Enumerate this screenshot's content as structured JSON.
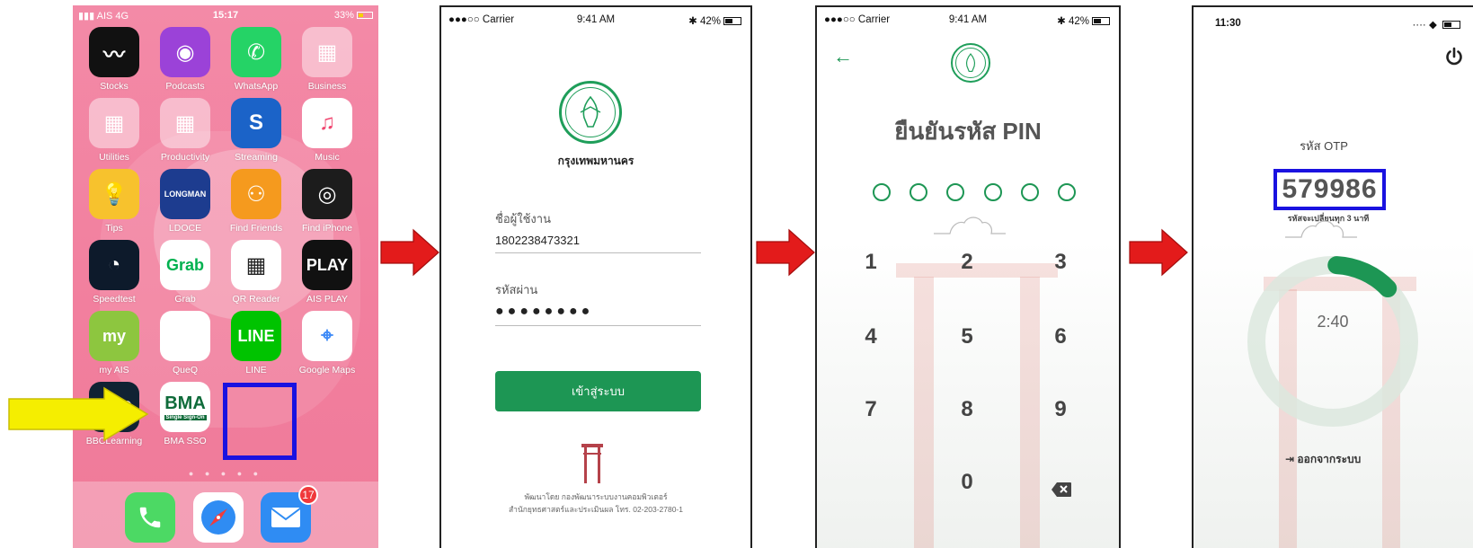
{
  "colors": {
    "accent_green": "#1d9654",
    "highlight_blue": "#1a12e0",
    "arrow_red": "#e31b1b",
    "arrow_yellow": "#f5ee00",
    "home_pink": "#f27f9e"
  },
  "screen1": {
    "status": {
      "carrier": "AIS",
      "network": "4G",
      "time": "15:17",
      "battery": "33%"
    },
    "apps": [
      {
        "label": "Stocks",
        "icon": "stocks-icon"
      },
      {
        "label": "Podcasts",
        "icon": "podcasts-icon"
      },
      {
        "label": "WhatsApp",
        "icon": "whatsapp-icon"
      },
      {
        "label": "Business",
        "icon": "folder-icon"
      },
      {
        "label": "Utilities",
        "icon": "folder-icon"
      },
      {
        "label": "Productivity",
        "icon": "folder-icon"
      },
      {
        "label": "Streaming",
        "icon": "shazam-icon"
      },
      {
        "label": "Music",
        "icon": "music-icon"
      },
      {
        "label": "Tips",
        "icon": "lightbulb-icon"
      },
      {
        "label": "LDOCE",
        "icon": "longman-icon",
        "icon_text": "LONGMAN"
      },
      {
        "label": "Find Friends",
        "icon": "friends-icon"
      },
      {
        "label": "Find iPhone",
        "icon": "radar-icon"
      },
      {
        "label": "Speedtest",
        "icon": "speedometer-icon"
      },
      {
        "label": "Grab",
        "icon": "grab-icon",
        "icon_text": "Grab"
      },
      {
        "label": "QR Reader",
        "icon": "qr-code-icon"
      },
      {
        "label": "AIS PLAY",
        "icon": "play-icon",
        "icon_text": "PLAY"
      },
      {
        "label": "my AIS",
        "icon": "my-ais-icon",
        "icon_text": "my"
      },
      {
        "label": "QueQ",
        "icon": "queq-icon"
      },
      {
        "label": "LINE",
        "icon": "line-icon",
        "icon_text": "LINE"
      },
      {
        "label": "Google Maps",
        "icon": "map-icon"
      },
      {
        "label": "BBCLearning",
        "icon": "bbc-icon",
        "icon_text": "BBC"
      },
      {
        "label": "BMA SSO",
        "icon": "bma-sso-icon",
        "icon_text": "BMA",
        "icon_subtext": "Single Sign-On"
      }
    ],
    "dock": [
      {
        "icon": "phone-icon"
      },
      {
        "icon": "safari-icon"
      },
      {
        "icon": "mail-icon",
        "badge": "17"
      }
    ]
  },
  "screen2": {
    "status": {
      "carrier": "●●●○○ Carrier",
      "time": "9:41 AM",
      "battery": "42%"
    },
    "org_name": "กรุงเทพมหานคร",
    "username_label": "ชื่อผู้ใช้งาน",
    "username_value": "1802238473321",
    "password_label": "รหัสผ่าน",
    "password_value": "●●●●●●●●",
    "login_button": "เข้าสู่ระบบ",
    "footer_line1": "พัฒนาโดย กองพัฒนาระบบงานคอมพิวเตอร์",
    "footer_line2": "สำนักยุทธศาสตร์และประเมินผล โทร. 02-203-2780-1"
  },
  "screen3": {
    "status": {
      "carrier": "●●●○○ Carrier",
      "time": "9:41 AM",
      "battery": "42%"
    },
    "title": "ยืนยันรหัส PIN",
    "keys": [
      "1",
      "2",
      "3",
      "4",
      "5",
      "6",
      "7",
      "8",
      "9",
      "0"
    ]
  },
  "screen4": {
    "status": {
      "time": "11:30"
    },
    "otp_label": "รหัส OTP",
    "otp_code": "579986",
    "otp_note": "รหัสจะเปลี่ยนทุก 3 นาที",
    "timer": "2:40",
    "timer_progress": 0.12,
    "logout": "ออกจากระบบ"
  }
}
